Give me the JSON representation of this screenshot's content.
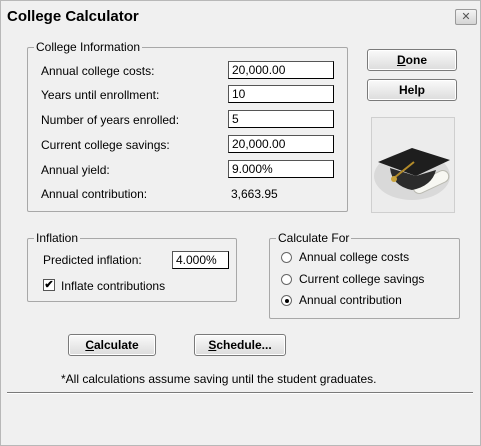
{
  "window": {
    "title": "College Calculator",
    "close_glyph": "✕"
  },
  "college_info": {
    "legend": "College Information",
    "fields": [
      {
        "label": "Annual college costs:",
        "value": "20,000.00"
      },
      {
        "label": "Years until enrollment:",
        "value": "10"
      },
      {
        "label": "Number of years enrolled:",
        "value": "5"
      },
      {
        "label": "Current college savings:",
        "value": "20,000.00"
      },
      {
        "label": "Annual yield:",
        "value": "9.000%"
      }
    ],
    "contribution_label": "Annual contribution:",
    "contribution_value": "3,663.95"
  },
  "buttons": {
    "done_prefix": "",
    "done_mnemonic": "D",
    "done_rest": "one",
    "help": "Help",
    "calculate_mnemonic": "C",
    "calculate_rest": "alculate",
    "schedule_mnemonic": "S",
    "schedule_rest": "chedule..."
  },
  "image": {
    "icon": "graduation-cap-diploma-photo"
  },
  "inflation": {
    "legend": "Inflation",
    "predicted_label": "Predicted inflation:",
    "predicted_value": "4.000%",
    "inflate_label": "Inflate contributions",
    "inflate_checked": true,
    "check_glyph": "✔"
  },
  "calculate_for": {
    "legend": "Calculate For",
    "options": [
      {
        "label": "Annual college costs",
        "selected": false
      },
      {
        "label": "Current college savings",
        "selected": false
      },
      {
        "label": "Annual contribution",
        "selected": true
      }
    ]
  },
  "footnote": "*All calculations assume saving until the student graduates."
}
